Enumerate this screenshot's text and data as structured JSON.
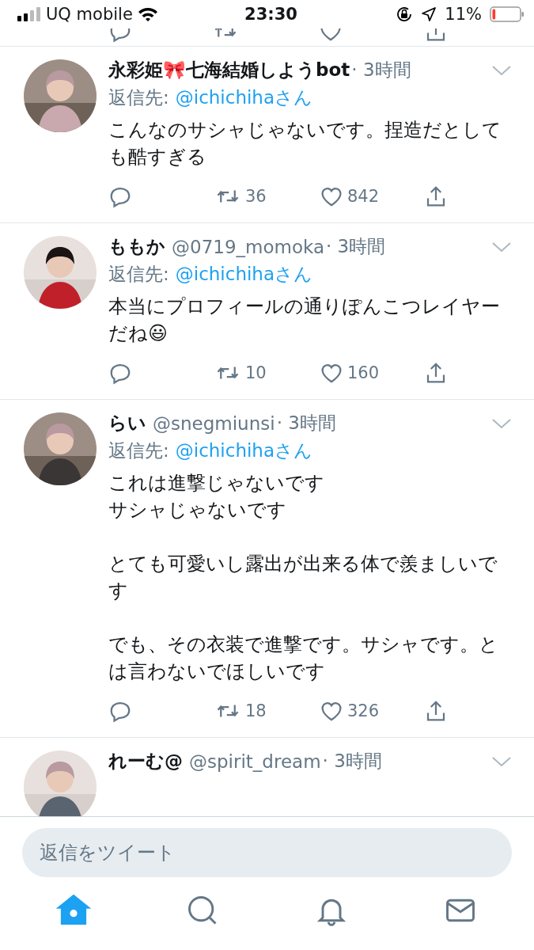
{
  "status_bar": {
    "carrier": "UQ mobile",
    "time": "23:30",
    "battery_percent": "11%"
  },
  "tweets": [
    {
      "name": "永彩姫🎀七海結婚しようbot",
      "time": "· 3時間",
      "reply_label": "返信先:",
      "reply_user": "@ichichihaさん",
      "body": [
        [
          "こんなのサシャじゃないです。捏造だとしても酷すぎる"
        ]
      ],
      "retweets": "36",
      "likes": "842"
    },
    {
      "name": "ももか",
      "handle": "@0719_momoka",
      "time": "· 3時間",
      "reply_label": "返信先:",
      "reply_user": "@ichichihaさん",
      "body": [
        [
          "本当にプロフィールの通りぽんこつレイヤーだね😃"
        ]
      ],
      "retweets": "10",
      "likes": "160"
    },
    {
      "name": "らい",
      "handle": "@snegmiunsi",
      "time": "· 3時間",
      "reply_label": "返信先:",
      "reply_user": "@ichichihaさん",
      "body": [
        [
          "これは進撃じゃないです",
          "サシャじゃないです"
        ],
        [
          "とても可愛いし露出が出来る体で羨ましいです"
        ],
        [
          "でも、その衣装で進撃です。サシャです。とは言わないでほしいです"
        ]
      ],
      "retweets": "18",
      "likes": "326"
    },
    {
      "name": "れーむ@",
      "handle": "@spirit_dream",
      "time": "· 3時間"
    }
  ],
  "reply_field": {
    "placeholder": "返信をツイート"
  },
  "tabs": [
    {
      "kind": "home",
      "selected": true
    },
    {
      "kind": "search",
      "selected": false
    },
    {
      "kind": "notifications",
      "selected": false
    },
    {
      "kind": "messages",
      "selected": false
    }
  ]
}
